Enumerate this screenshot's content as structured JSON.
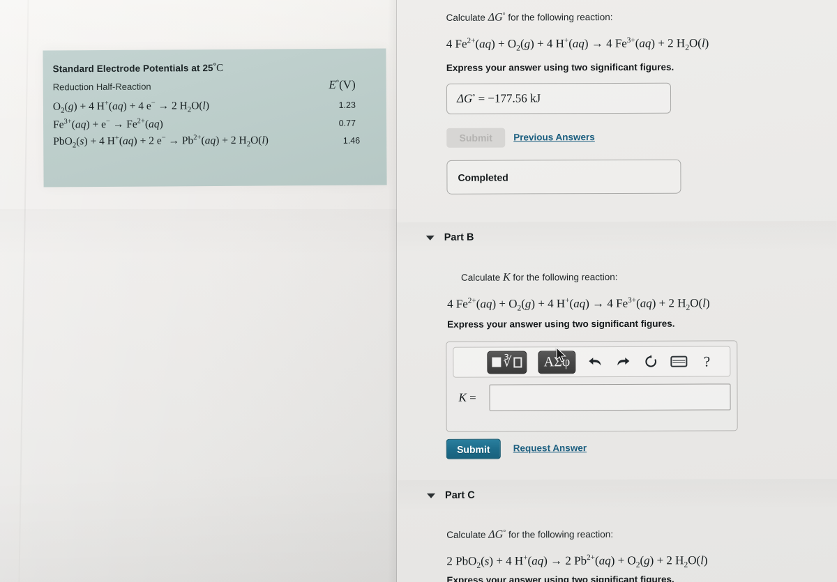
{
  "table": {
    "title_prefix": "Standard Electrode Potentials at 25",
    "title_deg": "°",
    "title_unit": "C",
    "col_left_header": "Reduction Half-Reaction",
    "col_right_header_symbol": "E",
    "col_right_header_deg": "°",
    "col_right_header_unit": "(V)",
    "rows": [
      {
        "reaction_html": "O<sub>2</sub>(<i>g</i>) + 4 H<sup>+</sup>(<i>aq</i>) + 4 e<sup>−</sup> → 2 H<sub>2</sub>O(<i>l</i>)",
        "value": "1.23"
      },
      {
        "reaction_html": "Fe<sup>3+</sup>(<i>aq</i>) + e<sup>−</sup> → Fe<sup>2+</sup>(<i>aq</i>)",
        "value": "0.77"
      },
      {
        "reaction_html": "PbO<sub>2</sub>(<i>s</i>) + 4 H<sup>+</sup>(<i>aq</i>) + 2 e<sup>−</sup> → Pb<sup>2+</sup>(<i>aq</i>) + 2 H<sub>2</sub>O(<i>l</i>)",
        "value": "1.46"
      }
    ]
  },
  "part_a": {
    "prompt_prefix": "Calculate ",
    "prompt_symbol": "ΔG",
    "prompt_symbol_deg": "°",
    "prompt_suffix": " for the following reaction:",
    "equation_html": "4 Fe<sup>2+</sup>(<i>aq</i>) + O<sub>2</sub>(<i>g</i>) + 4 H<sup>+</sup>(<i>aq</i>) → 4 Fe<sup>3+</sup>(<i>aq</i>) + 2 H<sub>2</sub>O(<i>l</i>)",
    "sigfig_note": "Express your answer using two significant figures.",
    "answer_symbol": "ΔG",
    "answer_symbol_deg": "°",
    "answer_value": " =  −177.56  kJ",
    "submit_label": "Submit",
    "previous_answers_label": "Previous Answers",
    "status_label": "Completed"
  },
  "part_b": {
    "header_label": "Part B",
    "prompt_prefix": "Calculate ",
    "prompt_symbol": "K",
    "prompt_suffix": " for the following reaction:",
    "equation_html": "4 Fe<sup>2+</sup>(<i>aq</i>) + O<sub>2</sub>(<i>g</i>) + 4 H<sup>+</sup>(<i>aq</i>) → 4 Fe<sup>3+</sup>(<i>aq</i>) + 2 H<sub>2</sub>O(<i>l</i>)",
    "sigfig_note": "Express your answer using two significant figures.",
    "toolbar": {
      "template_button_label": "template-nth-root",
      "greek_button_label": "ΑΣφ",
      "undo_label": "undo",
      "redo_label": "redo",
      "reset_label": "reset",
      "keyboard_label": "keyboard",
      "help_label": "?"
    },
    "input_label_symbol": "K",
    "input_label_eq": " =",
    "input_value": "",
    "input_placeholder": "",
    "submit_label": "Submit",
    "request_answer_label": "Request Answer"
  },
  "part_c": {
    "header_label": "Part C",
    "prompt_prefix": "Calculate ",
    "prompt_symbol": "ΔG",
    "prompt_symbol_deg": "°",
    "prompt_suffix": " for the following reaction:",
    "equation_html": "2 PbO<sub>2</sub>(<i>s</i>) + 4 H<sup>+</sup>(<i>aq</i>) → 2 Pb<sup>2+</sup>(<i>aq</i>) + O<sub>2</sub>(<i>g</i>) + 2 H<sub>2</sub>O(<i>l</i>)",
    "sigfig_note": "Express your answer using two significant figures."
  },
  "colors": {
    "table_bg": "#bdcecb",
    "submit_blue": "#1d6c8a",
    "link_blue": "#1c5f80",
    "page_bg": "#eceae6",
    "toolbar_btn_dark": "#464646"
  }
}
